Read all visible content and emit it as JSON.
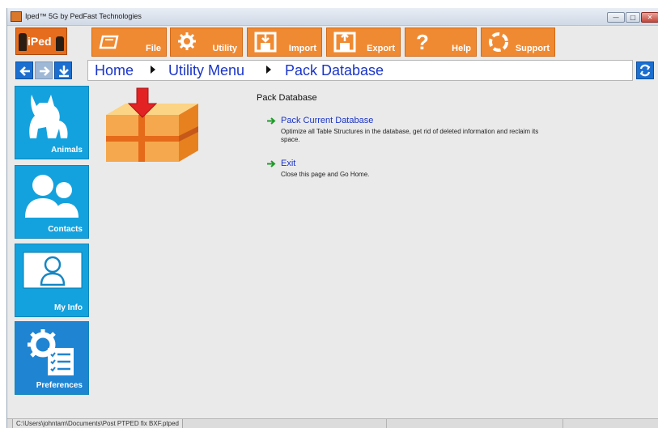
{
  "window": {
    "title": "Iped™ 5G by PedFast Technologies",
    "minimize_icon": "minimize-icon",
    "maximize_icon": "maximize-icon",
    "close_icon": "close-icon"
  },
  "toolbar": {
    "logo_text": "iPed",
    "buttons": [
      {
        "label": "File",
        "icon": "file-icon"
      },
      {
        "label": "Utility",
        "icon": "gear-icon"
      },
      {
        "label": "Import",
        "icon": "import-icon"
      },
      {
        "label": "Export",
        "icon": "export-icon"
      },
      {
        "label": "Help",
        "icon": "question-icon"
      },
      {
        "label": "Support",
        "icon": "lifebuoy-icon"
      }
    ],
    "accent": "#f08a32"
  },
  "nav": {
    "back_icon": "arrow-left-icon",
    "forward_icon": "arrow-right-icon",
    "down_icon": "arrow-down-icon",
    "breadcrumb": [
      "Home",
      "Utility Menu",
      "Pack Database"
    ],
    "refresh_icon": "refresh-icon",
    "accent": "#1b6fd0"
  },
  "sidebar": {
    "items": [
      {
        "label": "Animals",
        "icon": "dog-icon"
      },
      {
        "label": "Contacts",
        "icon": "people-icon"
      },
      {
        "label": "My Info",
        "icon": "person-card-icon"
      },
      {
        "label": "Preferences",
        "icon": "settings-list-icon"
      }
    ],
    "tile_color": "#14a2de"
  },
  "main": {
    "heading": "Pack Database",
    "illustration": "box-with-down-arrow-icon",
    "actions": [
      {
        "label": "Pack Current Database",
        "description": "Optimize all Table Structures in the database, get rid of deleted information and reclaim its space."
      },
      {
        "label": "Exit",
        "description": "Close this page and Go Home."
      }
    ]
  },
  "status": {
    "path": "C:\\Users\\johntam\\Documents\\Post PTPED fix BXF.ptped"
  }
}
